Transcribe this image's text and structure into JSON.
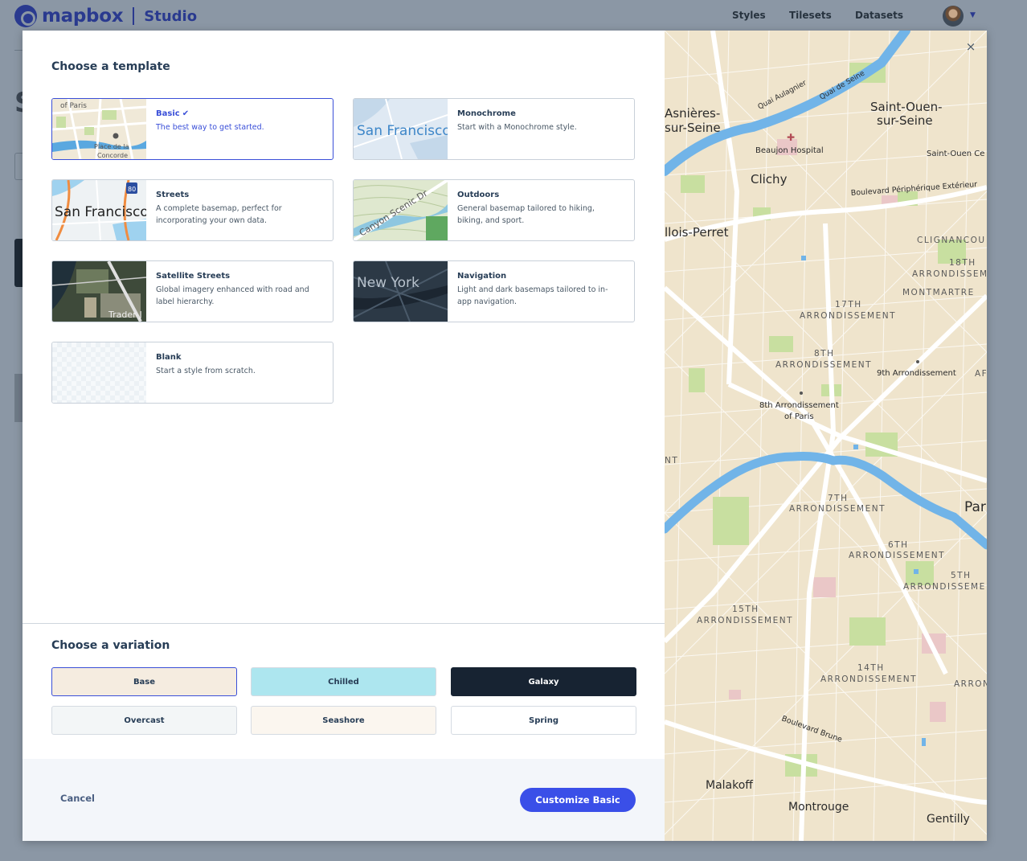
{
  "app": {
    "brand": "mapbox",
    "product": "Studio"
  },
  "nav": {
    "items": [
      "Styles",
      "Tilesets",
      "Datasets"
    ]
  },
  "modal": {
    "template_heading": "Choose a template",
    "templates": [
      {
        "name": "Basic",
        "desc": "The best way to get started.",
        "selected": true,
        "thumb_text": "of Paris",
        "thumb_text2": "Place de la Concorde"
      },
      {
        "name": "Monochrome",
        "desc": "Start with a Monochrome style.",
        "selected": false,
        "thumb_text": "San Francisco"
      },
      {
        "name": "Streets",
        "desc": "A complete basemap, perfect for incorporating your own data.",
        "selected": false,
        "thumb_text": "San Francisco"
      },
      {
        "name": "Outdoors",
        "desc": "General basemap tailored to hiking, biking, and sport.",
        "selected": false,
        "thumb_text": "Canyon Scenic Dr"
      },
      {
        "name": "Satellite Streets",
        "desc": "Global imagery enhanced with road and label hierarchy.",
        "selected": false,
        "thumb_text": "Trader-J"
      },
      {
        "name": "Navigation",
        "desc": "Light and dark basemaps tailored to in-app navigation.",
        "selected": false,
        "thumb_text": "New York"
      },
      {
        "name": "Blank",
        "desc": "Start a style from scratch.",
        "selected": false
      }
    ],
    "variation_heading": "Choose a variation",
    "variations": [
      {
        "label": "Base",
        "bg": "#f5ece0",
        "fg": "#273d56",
        "selected": true
      },
      {
        "label": "Chilled",
        "bg": "#ade6ef",
        "fg": "#273d56",
        "selected": false
      },
      {
        "label": "Galaxy",
        "bg": "#172332",
        "fg": "#ffffff",
        "selected": false
      },
      {
        "label": "Overcast",
        "bg": "#f3f6f7",
        "fg": "#273d56",
        "selected": false
      },
      {
        "label": "Seashore",
        "bg": "#fbf6ef",
        "fg": "#273d56",
        "selected": false
      },
      {
        "label": "Spring",
        "bg": "#ffffff",
        "fg": "#273d56",
        "selected": false
      }
    ],
    "cancel_label": "Cancel",
    "primary_label": "Customize Basic",
    "close_icon": "×"
  },
  "map": {
    "labels": {
      "asnieres": [
        "Asnières-",
        "sur-Seine"
      ],
      "saint_ouen": [
        "Saint-Ouen-",
        "sur-Seine"
      ],
      "saint_ouen_ce": "Saint-Ouen Ce",
      "clichy": "Clichy",
      "beaujon": "Beaujon Hospital",
      "levallois": "llois-Perret",
      "quai_aulagnier": "Quai Aulagnier",
      "quai_de_seine": "Quai de Seine",
      "peripherique": "Boulevard Périphérique Extérieur",
      "clignancourt": "CLIGNANCOU",
      "arr18": [
        "18TH",
        "ARRONDISSEM"
      ],
      "montmartre": "MONTMARTRE",
      "arr17": [
        "17TH",
        "ARRONDISSEMENT"
      ],
      "arr8": [
        "8TH",
        "ARRONDISSEMENT"
      ],
      "arr9": "9th Arrondissement",
      "arr8_paris": [
        "8th Arrondissement",
        "of Paris"
      ],
      "arr7": [
        "7TH",
        "ARRONDISSEMENT"
      ],
      "arr6": [
        "6TH",
        "ARRONDISSEMENT"
      ],
      "arr5": [
        "5TH",
        "ARRONDISSEME"
      ],
      "arr15": [
        "15TH",
        "ARRONDISSEMENT"
      ],
      "arr14": [
        "14TH",
        "ARRONDISSEMENT"
      ],
      "arron_right": "ARRON",
      "paris": "Par",
      "nt": "NT",
      "af": "AF",
      "boulevard_brune": "Boulevard Brune",
      "malakoff": "Malakoff",
      "montrouge": "Montrouge",
      "gentilly": "Gentilly"
    }
  }
}
